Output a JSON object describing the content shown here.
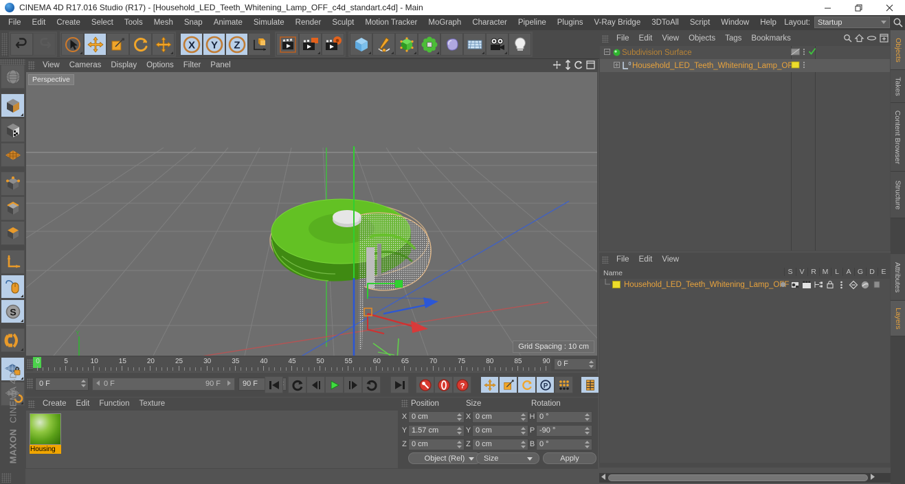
{
  "window": {
    "title": "CINEMA 4D R17.016 Studio (R17) - [Household_LED_Teeth_Whitening_Lamp_OFF_c4d_standart.c4d] - Main",
    "minimize_label": "Minimize",
    "maximize_label": "Restore",
    "close_label": "Close"
  },
  "menubar": {
    "items": [
      "File",
      "Edit",
      "Create",
      "Select",
      "Tools",
      "Mesh",
      "Snap",
      "Animate",
      "Simulate",
      "Render",
      "Sculpt",
      "Motion Tracker",
      "MoGraph",
      "Character",
      "Pipeline",
      "Plugins",
      "V-Ray Bridge",
      "3DToAll",
      "Script",
      "Window",
      "Help"
    ],
    "layout_label": "Layout:",
    "layout_value": "Startup",
    "search_icon": "search-icon"
  },
  "toolbar": {
    "groups": [
      {
        "name": "history",
        "buttons": [
          {
            "name": "undo",
            "icon": "undo-arrow-icon",
            "state": "normal"
          },
          {
            "name": "redo",
            "icon": "redo-arrow-icon",
            "state": "disabled"
          }
        ]
      },
      {
        "name": "tools",
        "buttons": [
          {
            "name": "live-selection",
            "icon": "cursor-select-icon",
            "state": "normal"
          },
          {
            "name": "move",
            "icon": "move-arrows-icon",
            "state": "selected"
          },
          {
            "name": "scale",
            "icon": "scale-box-icon",
            "state": "normal"
          },
          {
            "name": "rotate",
            "icon": "rotate-circle-icon",
            "state": "normal"
          },
          {
            "name": "transform",
            "icon": "move-arrows-icon",
            "state": "normal"
          }
        ]
      },
      {
        "name": "axis-locks",
        "buttons": [
          {
            "name": "lock-x",
            "icon": "axis-x-icon",
            "state": "selected"
          },
          {
            "name": "lock-y",
            "icon": "axis-y-icon",
            "state": "selected"
          },
          {
            "name": "lock-z",
            "icon": "axis-z-icon",
            "state": "selected"
          },
          {
            "name": "world-object-coords",
            "icon": "world-axis-cube-icon",
            "state": "normal"
          }
        ]
      },
      {
        "name": "render",
        "buttons": [
          {
            "name": "render-view",
            "icon": "clapper-render-icon",
            "state": "normal"
          },
          {
            "name": "render-to-picture-viewer",
            "icon": "clapper-picture-icon",
            "state": "normal"
          },
          {
            "name": "render-settings",
            "icon": "clapper-gear-icon",
            "state": "normal"
          }
        ]
      },
      {
        "name": "create",
        "buttons": [
          {
            "name": "add-cube-primitive",
            "icon": "blue-cube-icon",
            "state": "normal"
          },
          {
            "name": "add-spline",
            "icon": "pen-spline-icon",
            "state": "normal"
          },
          {
            "name": "add-generator",
            "icon": "green-cube-icon",
            "state": "normal"
          },
          {
            "name": "add-deformer",
            "icon": "green-cluster-icon",
            "state": "normal"
          },
          {
            "name": "add-scene-object",
            "icon": "purple-blob-icon",
            "state": "normal"
          },
          {
            "name": "add-environment",
            "icon": "floor-grid-icon",
            "state": "normal"
          },
          {
            "name": "add-camera",
            "icon": "camera-icon",
            "state": "normal"
          },
          {
            "name": "add-light",
            "icon": "lightbulb-icon",
            "state": "normal"
          }
        ]
      }
    ]
  },
  "left_palette": {
    "items": [
      {
        "name": "make-editable",
        "icon": "editable-sphere-icon",
        "state": "normal"
      },
      {
        "name": "model-mode",
        "icon": "model-cube-icon",
        "state": "selected"
      },
      {
        "name": "texture-mode",
        "icon": "texture-cube-icon",
        "state": "normal"
      },
      {
        "name": "workplane-mode",
        "icon": "workplane-grid-icon",
        "state": "normal"
      },
      {
        "name": "points-mode",
        "icon": "points-cube-icon",
        "state": "normal"
      },
      {
        "name": "edges-mode",
        "icon": "edges-cube-icon",
        "state": "normal"
      },
      {
        "name": "polygons-mode",
        "icon": "polygons-cube-icon",
        "state": "normal"
      },
      {
        "name": "enable-axis-modification",
        "icon": "axis-l-icon",
        "state": "normal"
      },
      {
        "name": "viewport-solo",
        "icon": "mouse-hand-icon",
        "state": "selected"
      },
      {
        "name": "soft-selection",
        "icon": "s-circle-icon",
        "state": "selected"
      },
      {
        "name": "enable-snap",
        "icon": "magnet-icon",
        "state": "normal"
      },
      {
        "name": "lock-workplane",
        "icon": "workplane-lock-icon",
        "state": "selected"
      },
      {
        "name": "planar-workplane",
        "icon": "workplane-rotate-icon",
        "state": "normal"
      }
    ],
    "brand_line1": "MAXON",
    "brand_line2": "CINEMA 4D"
  },
  "viewport": {
    "menu": [
      "View",
      "Cameras",
      "Display",
      "Filter",
      "Options",
      "Panel"
    ],
    "menu_order": [
      "View",
      "Cameras",
      "Display",
      "Options",
      "Filter",
      "Panel"
    ],
    "label": "Perspective",
    "grid_spacing": "Grid Spacing : 10 cm",
    "axis_labels": {
      "x": "X",
      "y": "Y",
      "z": "Z"
    },
    "nav_icons": [
      "pan-icon",
      "dolly-icon",
      "orbit-icon",
      "maximize-view-icon"
    ]
  },
  "timeline": {
    "ticks": [
      "0",
      "5",
      "10",
      "15",
      "20",
      "25",
      "30",
      "35",
      "40",
      "45",
      "50",
      "55",
      "60",
      "65",
      "70",
      "75",
      "80",
      "85",
      "90"
    ],
    "current_frame_field": "0 F",
    "start_frame": "0 F",
    "range_min": "0 F",
    "range_max": "90 F",
    "end_frame": "90 F",
    "playhead_frame": 0,
    "buttons": [
      {
        "name": "go-to-start",
        "icon": "skip-start-icon"
      },
      {
        "name": "previous-keyframe",
        "icon": "loop-back-icon"
      },
      {
        "name": "previous-frame",
        "icon": "step-back-icon"
      },
      {
        "name": "play-forwards",
        "icon": "play-icon"
      },
      {
        "name": "next-frame",
        "icon": "step-forward-icon"
      },
      {
        "name": "next-keyframe",
        "icon": "loop-forward-icon"
      },
      {
        "name": "go-to-end",
        "icon": "skip-end-icon"
      },
      {
        "name": "record-active-objects",
        "icon": "record-key-icon"
      },
      {
        "name": "autokeying",
        "icon": "autokey-icon"
      },
      {
        "name": "keyframe-selection",
        "icon": "question-key-icon"
      },
      {
        "name": "position-key",
        "icon": "position-key-icon"
      },
      {
        "name": "scale-key",
        "icon": "scale-key-icon"
      },
      {
        "name": "rotation-key",
        "icon": "rotation-key-icon"
      },
      {
        "name": "parameter-key",
        "icon": "param-p-key-icon"
      },
      {
        "name": "point-level-animation",
        "icon": "pla-dots-icon"
      },
      {
        "name": "timeline-toggle",
        "icon": "timeline-strip-icon"
      }
    ]
  },
  "material_manager": {
    "menu": [
      "Create",
      "Edit",
      "Function",
      "Texture"
    ],
    "materials": [
      {
        "name": "Housing",
        "label": "Housing",
        "selected": true
      }
    ]
  },
  "coordinates": {
    "headers": [
      "Position",
      "Size",
      "Rotation"
    ],
    "rows": [
      {
        "pos_label": "X",
        "pos_value": "0 cm",
        "size_label": "X",
        "size_value": "0 cm",
        "rot_label": "H",
        "rot_value": "0 °"
      },
      {
        "pos_label": "Y",
        "pos_value": "1.57 cm",
        "size_label": "Y",
        "size_value": "0 cm",
        "rot_label": "P",
        "rot_value": "-90 °"
      },
      {
        "pos_label": "Z",
        "pos_value": "0 cm",
        "size_label": "Z",
        "size_value": "0 cm",
        "rot_label": "B",
        "rot_value": "0 °"
      }
    ],
    "mode_select": "Object (Rel)",
    "size_select": "Size",
    "apply_label": "Apply"
  },
  "object_manager": {
    "menu": [
      "File",
      "Edit",
      "View",
      "Objects",
      "Tags",
      "Bookmarks"
    ],
    "icons": [
      "search-icon",
      "home-icon",
      "link-icon",
      "expand-icon"
    ],
    "rows": [
      {
        "name": "Subdivision Surface",
        "indent": 0,
        "icon": "subdivision-surface-icon",
        "dim": true,
        "tags": [
          "hatched-tag-icon",
          "dots-icon",
          "green-check-icon"
        ]
      },
      {
        "name": "Household_LED_Teeth_Whitening_Lamp_OFF",
        "indent": 1,
        "icon": "polygon-object-icon",
        "dim": false,
        "tags": [
          "yellow-material-tag",
          "dots-icon"
        ]
      }
    ]
  },
  "layer_manager": {
    "menu": [
      "File",
      "Edit",
      "View"
    ],
    "name_column": "Name",
    "flag_columns": [
      "S",
      "V",
      "R",
      "M",
      "L",
      "A",
      "G",
      "D",
      "E"
    ],
    "rows": [
      {
        "name": "Household_LED_Teeth_Whitening_Lamp_OFF",
        "color": "#ecdc2b"
      }
    ]
  },
  "right_tabs": {
    "upper": [
      {
        "label": "Objects",
        "active": true
      },
      {
        "label": "Takes",
        "active": false
      },
      {
        "label": "Content Browser",
        "active": false
      },
      {
        "label": "Structure",
        "active": false
      }
    ],
    "lower": [
      {
        "label": "Attributes",
        "active": false
      },
      {
        "label": "Layers",
        "active": true
      }
    ]
  },
  "colors": {
    "panel_bg": "#4a4a4a",
    "field_bg": "#5e5e5e",
    "viewport_bg": "#6e6e6e",
    "accent_orange": "#e8a33d",
    "selected_blue": "#b9cfe8",
    "axis_x": "#d04040",
    "axis_y": "#3ec43e",
    "axis_z": "#3a5fd0",
    "material_yellow": "#ecdc2b",
    "model_green": "#63c124",
    "playhead_green": "#4bd14b"
  }
}
